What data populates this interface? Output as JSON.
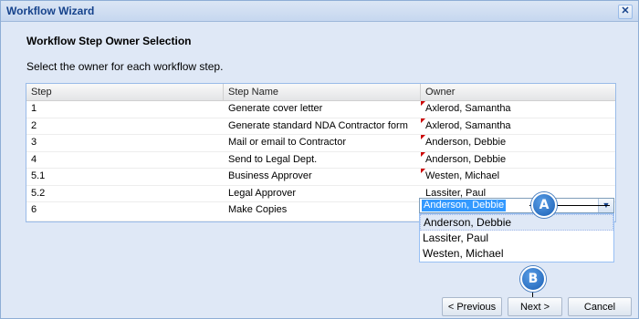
{
  "window": {
    "title": "Workflow Wizard",
    "close_glyph": "✕"
  },
  "heading": "Workflow Step Owner Selection",
  "instruction": "Select the owner for each workflow step.",
  "grid": {
    "columns": [
      "Step",
      "Step Name",
      "Owner"
    ],
    "rows": [
      {
        "step": "1",
        "name": "Generate cover letter",
        "owner": "Axlerod, Samantha",
        "dirty": true
      },
      {
        "step": "2",
        "name": "Generate standard NDA Contractor form",
        "owner": "Axlerod, Samantha",
        "dirty": true
      },
      {
        "step": "3",
        "name": "Mail or email to Contractor",
        "owner": "Anderson, Debbie",
        "dirty": true
      },
      {
        "step": "4",
        "name": "Send to Legal Dept.",
        "owner": "Anderson, Debbie",
        "dirty": true
      },
      {
        "step": "5.1",
        "name": "Business Approver",
        "owner": "Westen, Michael",
        "dirty": true
      },
      {
        "step": "5.2",
        "name": "Legal Approver",
        "owner": "Lassiter, Paul",
        "dirty": false
      },
      {
        "step": "6",
        "name": "Make Copies",
        "owner": "Anderson, Debbie",
        "dirty": false
      }
    ]
  },
  "owner_combo": {
    "value": "Anderson, Debbie",
    "options": [
      "Anderson, Debbie",
      "Lassiter, Paul",
      "Westen, Michael"
    ]
  },
  "callouts": {
    "a": "A",
    "b": "B"
  },
  "buttons": {
    "previous": "< Previous",
    "next": "Next >",
    "cancel": "Cancel"
  },
  "icons": {
    "dropdown": "chevron-down-icon",
    "close": "close-icon"
  }
}
